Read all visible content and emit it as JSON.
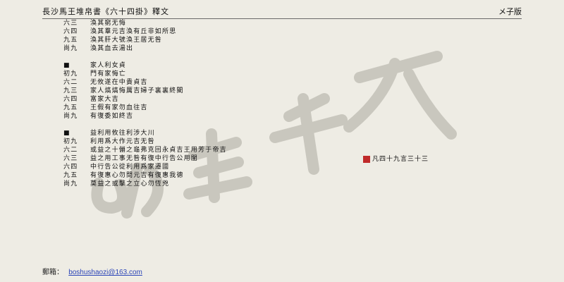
{
  "header": {
    "title": "長沙馬王堆帛書《六十四掛》釋文",
    "edition": "メ子版"
  },
  "sections": [
    {
      "lines": [
        {
          "label": "六三",
          "text": "渙其窮无悔"
        },
        {
          "label": "六四",
          "text": "渙其羣元吉渙有丘非如所思"
        },
        {
          "label": "九五",
          "text": "渙其肝大號渙王居无咎"
        },
        {
          "label": "尚九",
          "text": "渙其血去湯出"
        }
      ]
    },
    {
      "lines": [
        {
          "label": "■",
          "text": "家人利女貞"
        },
        {
          "label": "初九",
          "text": "門有家悔亡"
        },
        {
          "label": "六二",
          "text": "无攸遂在中貴貞吉"
        },
        {
          "label": "九三",
          "text": "家人熇熇悔厲吉婦子裏裏終閵"
        },
        {
          "label": "六四",
          "text": "富家大吉"
        },
        {
          "label": "九五",
          "text": "王假有家勿血往吉"
        },
        {
          "label": "尚九",
          "text": "有復委如終吉"
        }
      ]
    },
    {
      "lines": [
        {
          "label": "■",
          "text": "益利用攸往利涉大川"
        },
        {
          "label": "初九",
          "text": "利用爲大作元吉无咎"
        },
        {
          "label": "六二",
          "text": "或益之十傰之龜弗克回永貞吉王用芳于帝吉"
        },
        {
          "label": "六三",
          "text": "益之用工事无咎有復中行告公用閨"
        },
        {
          "label": "六四",
          "text": "中行告公從利用爲家遷國"
        },
        {
          "label": "九五",
          "text": "有復惠心勿問元吉有復惠我德"
        },
        {
          "label": "尚九",
          "text": "莫益之或擊之立心勿恆兇"
        }
      ]
    }
  ],
  "page_number": "凡四十九言三十三",
  "footer": {
    "label": "郵箱：",
    "email": "boshushaozi@163.com"
  },
  "colors": {
    "background": "#eeece4",
    "seal": "#c02a2a",
    "link": "#2b45b8",
    "watermark": "#c9c7be"
  },
  "icons": {
    "seal": "red-seal-stamp",
    "watermark": "calligraphy-watermark"
  }
}
